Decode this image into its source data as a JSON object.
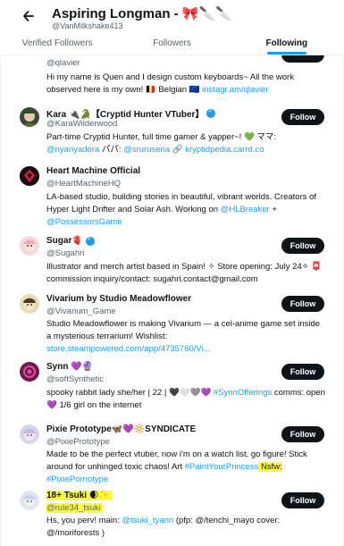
{
  "header": {
    "title": "Aspiring Longman - 🎀🔪🔪",
    "handle": "@VanMilkshake413"
  },
  "tabs": [
    {
      "label": "Verified Followers"
    },
    {
      "label": "Followers"
    },
    {
      "label": "Following"
    }
  ],
  "follow_label": "Follow",
  "accounts": [
    {
      "handle": "@qlavier",
      "bio_text": "Hi my name is Quen and I design custom keyboards~ All the work observed here is my own! 🇧🇪 Belgian 🇪🇺 ",
      "bio_link": "instagr.am/qlavier"
    },
    {
      "name": "Kara 🔌🐊【Cryptid Hunter VTuber】",
      "handle": "@KaraWilderwood",
      "bio_text": "Part-time Cryptid Hunter, full time gamer & yapper~! 💚 ママ: ",
      "bio_link": "@nyanyadora",
      "bio_text2": " パパ: ",
      "bio_link2": "@sruruseria",
      "bio_text3": " 🔗 ",
      "bio_link3": "kryptidpedia.carrd.co"
    },
    {
      "name": "Heart Machine Official",
      "handle": "@HeartMachineHQ",
      "bio_text": "LA-based studio, building stories in beautiful, vibrant worlds. Creators of Hyper Light Drifter and Solar Ash. Working on ",
      "bio_link": "@HLBreaker",
      "bio_text2": " + ",
      "bio_link2": "@PossessorsGame"
    },
    {
      "name": "Sugar🫀",
      "handle": "@Sugahri",
      "bio_text": "Illustrator and merch artist based in Spain! ✧ Store opening: July 24✧ 📮 commission inquiry/contact: sugahri.contact@gmail.com"
    },
    {
      "name": "Vivarium by Studio Meadowflower",
      "handle": "@Vivarium_Game",
      "bio_text": "Studio Meadowflower is making Vivarium — a cel-anime game set inside a mysterious terrarium! Wishlist: ",
      "bio_link": "store.steampowered.com/app/4735760/Vi..."
    },
    {
      "name": "Synn 💜🔮",
      "handle": "@softSynthetic",
      "bio_text": "spooky rabbit lady she/her | 22 | 🖤🤍🩶💜 ",
      "bio_link": "#SynnOfferings",
      "bio_text2": " comms: open 💜 1/6 girl on the internet"
    },
    {
      "name": "Pixie Prototype🦋💜🔆SYNDICATE",
      "handle": "@PixiePrototype",
      "bio_text": "Made to be the perfect vtuber, now i'm on a watch list, go figure! Stick around for unhinged toxic chaos! Art ",
      "bio_link": "#PaintYourPrincess",
      "bio_text2": " Nsfw: ",
      "bio_link2": "#PixiePornotype"
    },
    {
      "name": "18+ Tsuki 🌒✨",
      "handle": "@rule34_tsuki",
      "bio_text": "Hs, you perv! main: ",
      "bio_link": "@tsuki_tyann",
      "bio_text2": " (pfp: @/tenchi_mayo cover: @/moriforests )"
    }
  ]
}
